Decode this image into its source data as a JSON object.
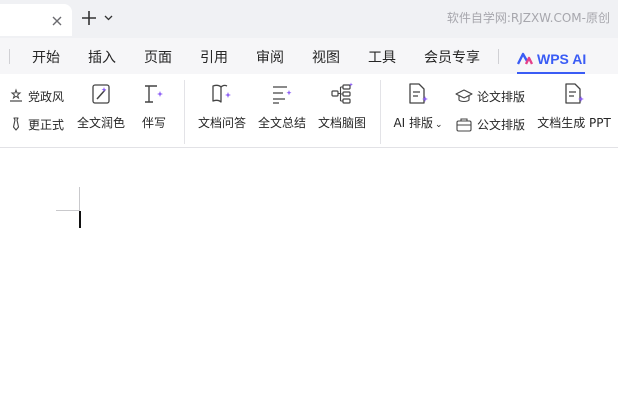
{
  "titlebar": {
    "close_icon": "close-icon",
    "new_tab_icon": "plus-icon",
    "watermark": "软件自学网:RJZXW.COM-原创"
  },
  "menu": {
    "items": [
      "开始",
      "插入",
      "页面",
      "引用",
      "审阅",
      "视图",
      "工具",
      "会员专享"
    ],
    "active": "WPS AI",
    "accent": "#3a5cf5"
  },
  "ribbon": {
    "group1": {
      "small_buttons": [
        {
          "label": "党政风",
          "icon": "flag-icon"
        },
        {
          "label": "更正式",
          "icon": "tie-icon"
        }
      ],
      "big_buttons": [
        {
          "label": "全文润色",
          "icon": "magic-wand-icon"
        },
        {
          "label": "伴写",
          "icon": "text-cursor-sparkle-icon"
        }
      ]
    },
    "group2": {
      "big_buttons": [
        {
          "label": "文档问答",
          "icon": "book-sparkle-icon"
        },
        {
          "label": "全文总结",
          "icon": "list-sparkle-icon"
        },
        {
          "label": "文档脑图",
          "icon": "mindmap-sparkle-icon"
        }
      ]
    },
    "group3": {
      "big_buttons": [
        {
          "label": "AI 排版",
          "icon": "document-sparkle-icon"
        },
        {
          "label": "文档生成 PPT",
          "icon": "document-ppt-icon"
        }
      ],
      "small_buttons": [
        {
          "label": "论文排版",
          "icon": "graduation-cap-icon"
        },
        {
          "label": "公文排版",
          "icon": "briefcase-icon"
        }
      ]
    }
  }
}
